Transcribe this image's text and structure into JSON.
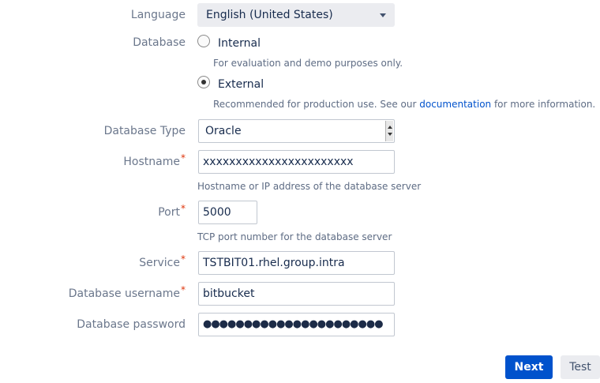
{
  "language": {
    "label": "Language",
    "value": "English (United States)"
  },
  "database": {
    "label": "Database",
    "internal": {
      "label": "Internal",
      "help": "For evaluation and demo purposes only.",
      "checked": false
    },
    "external": {
      "label": "External",
      "help_before": "Recommended for production use. See our ",
      "help_link": "documentation",
      "help_after": " for more information.",
      "checked": true
    }
  },
  "database_type": {
    "label": "Database Type",
    "value": "Oracle"
  },
  "hostname": {
    "label": "Hostname",
    "required": "*",
    "value": "xxxxxxxxxxxxxxxxxxxxxxx",
    "help": "Hostname or IP address of the database server"
  },
  "port": {
    "label": "Port",
    "required": "*",
    "value": "5000",
    "help": "TCP port number for the database server"
  },
  "service": {
    "label": "Service",
    "required": "*",
    "value": "TSTBIT01.rhel.group.intra"
  },
  "username": {
    "label": "Database username",
    "required": "*",
    "value": "bitbucket"
  },
  "password": {
    "label": "Database password",
    "value": "●●●●●●●●●●●●●●●●●●●●●●"
  },
  "buttons": {
    "next": "Next",
    "test": "Test"
  },
  "colors": {
    "primary": "#0052cc",
    "required": "#de350b",
    "link": "#0052cc"
  }
}
